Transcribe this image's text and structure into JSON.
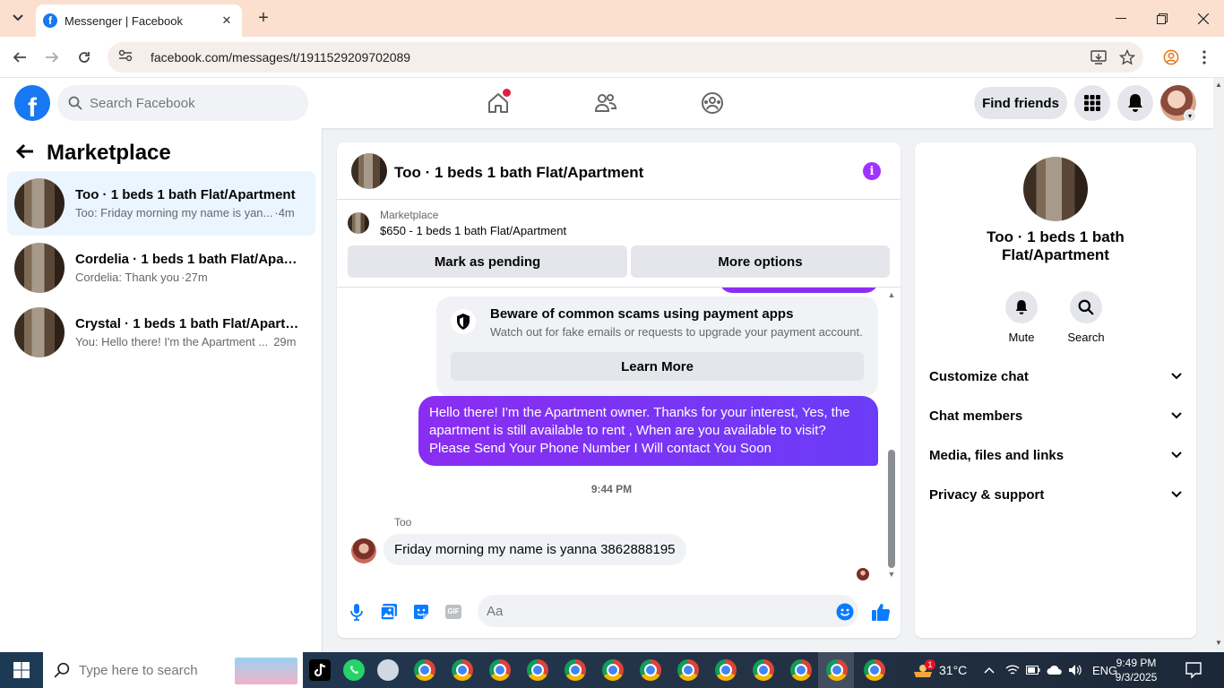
{
  "browser": {
    "tab_title": "Messenger | Facebook",
    "url": "facebook.com/messages/t/1911529209702089"
  },
  "fb": {
    "search_placeholder": "Search Facebook",
    "find_friends": "Find friends"
  },
  "left": {
    "title": "Marketplace",
    "conversations": [
      {
        "name": "Too · 1 beds 1 bath Flat/Apartment",
        "snippet": "Too: Friday morning my name is yan...",
        "time": "·4m",
        "active": true
      },
      {
        "name": "Cordelia · 1 beds 1 bath Flat/Apart...",
        "snippet": "Cordelia: Thank you",
        "time": "·27m",
        "active": false
      },
      {
        "name": "Crystal · 1 beds 1 bath Flat/Apartm...",
        "snippet": "You: Hello there! I'm the Apartment ...",
        "time": "29m",
        "active": false
      }
    ]
  },
  "chat": {
    "title": "Too · 1 beds 1 bath Flat/Apartment",
    "marketplace_label": "Marketplace",
    "listing": "$650 - 1 beds 1 bath Flat/Apartment",
    "mark_pending": "Mark as pending",
    "more_options": "More options",
    "scam_title": "Beware of common scams using payment apps",
    "scam_desc": "Watch out for fake emails or requests to upgrade your payment account.",
    "learn_more": "Learn More",
    "outgoing_message": "Hello there! I'm the Apartment owner. Thanks for your interest, Yes, the apartment is still available to rent , When are you available to visit? Please Send Your Phone Number I Will contact You Soon",
    "timestamp": "9:44 PM",
    "sender": "Too",
    "incoming_message": "Friday morning my name is yanna 3862888195",
    "composer_placeholder": "Aa",
    "gif_label": "GIF"
  },
  "right": {
    "name": "Too · 1 beds 1 bath Flat/Apartment",
    "mute": "Mute",
    "search": "Search",
    "sections": [
      "Customize chat",
      "Chat members",
      "Media, files and links",
      "Privacy & support"
    ]
  },
  "taskbar": {
    "search_placeholder": "Type here to search",
    "weather": "31°C",
    "weather_badge": "1",
    "language": "ENG",
    "time": "9:49 PM",
    "date": "9/3/2025"
  },
  "colors": {
    "fb_blue": "#1877f2",
    "messenger_purple": "#7c2ff4",
    "active_row": "#ebf5ff"
  }
}
